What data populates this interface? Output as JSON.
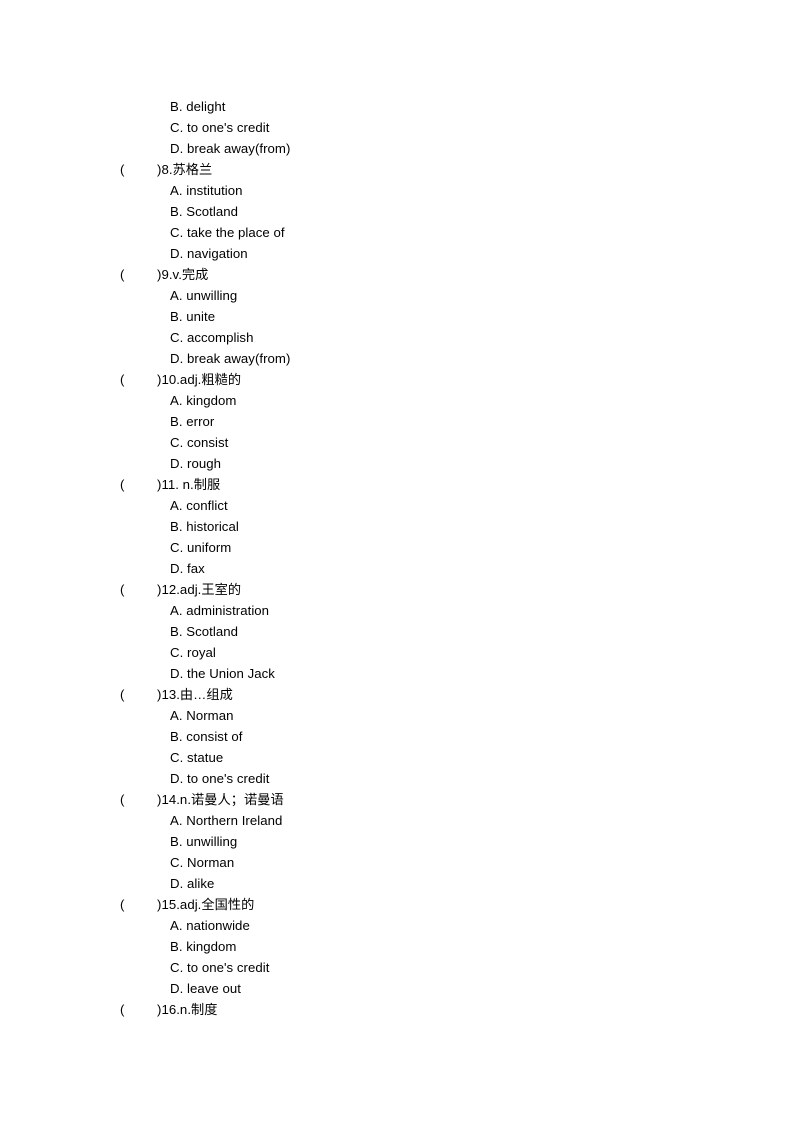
{
  "document": {
    "type": "vocabulary-multiple-choice-worksheet",
    "continued_options_at_top": [
      "B. delight",
      "C. to one's credit",
      "D. break away(from)"
    ],
    "questions": [
      {
        "marker_open": "(",
        "marker_close": ")",
        "stem": "8.苏格兰",
        "options": [
          "A. institution",
          "B. Scotland",
          "C. take the place of",
          "D. navigation"
        ]
      },
      {
        "marker_open": "(",
        "marker_close": ")",
        "stem": "9.v.完成",
        "options": [
          "A. unwilling",
          "B. unite",
          "C. accomplish",
          "D. break away(from)"
        ]
      },
      {
        "marker_open": "(",
        "marker_close": ")",
        "stem": "10.adj.粗糙的",
        "options": [
          "A. kingdom",
          "B. error",
          "C. consist",
          "D. rough"
        ]
      },
      {
        "marker_open": "(",
        "marker_close": ")",
        "stem": "11. n.制服",
        "options": [
          "A. conflict",
          "B. historical",
          "C. uniform",
          "D. fax"
        ]
      },
      {
        "marker_open": "(",
        "marker_close": ")",
        "stem": "12.adj.王室的",
        "options": [
          "A. administration",
          "B. Scotland",
          "C. royal",
          "D. the Union Jack"
        ]
      },
      {
        "marker_open": "(",
        "marker_close": ")",
        "stem": "13.由…组成",
        "options": [
          "A. Norman",
          "B. consist of",
          "C. statue",
          "D. to one's credit"
        ]
      },
      {
        "marker_open": "(",
        "marker_close": ")",
        "stem": "14.n.诺曼人；诺曼语",
        "options": [
          "A. Northern Ireland",
          "B. unwilling",
          "C. Norman",
          "D. alike"
        ]
      },
      {
        "marker_open": "(",
        "marker_close": ")",
        "stem": "15.adj.全国性的",
        "options": [
          "A. nationwide",
          "B. kingdom",
          "C. to one's credit",
          "D. leave out"
        ]
      },
      {
        "marker_open": "(",
        "marker_close": ")",
        "stem": "16.n.制度",
        "options": []
      }
    ]
  }
}
